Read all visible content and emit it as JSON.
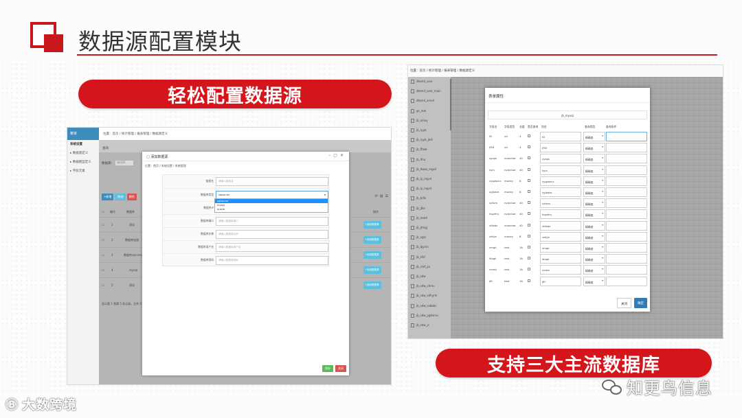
{
  "slide": {
    "title": "数据源配置模块",
    "pill_left": "轻松配置数据源",
    "pill_right": "支持三大主流数据库",
    "colors": {
      "accent": "#c8161d",
      "pill": "#d4161c",
      "link_blue": "#3c8dbc"
    }
  },
  "left_app": {
    "sidebar_header": "菜单",
    "sidebar_items": [
      "系统设置",
      "数据源定义",
      "数据模型定义",
      "字段元素"
    ],
    "breadcrumb": "位置：首页 / 统计管理 / 报表管理 / 数据源定义",
    "panel_header": "查询",
    "search_label": "数据库：",
    "search_value": "请选择...",
    "buttons": [
      "+新增",
      "/修改",
      "删除"
    ],
    "columns": [
      "编号",
      "数据库",
      "操作"
    ],
    "rows": [
      {
        "no": "1",
        "db": "测试",
        "op": "+添加数据源"
      },
      {
        "no": "2",
        "db": "数据库连接",
        "op": "+添加数据源"
      },
      {
        "no": "3",
        "db": "数据库sql server",
        "op": "+添加数据源"
      },
      {
        "no": "4",
        "db": "mysql",
        "op": "+添加数据源"
      },
      {
        "no": "5",
        "db": "测试",
        "op": "+添加数据源"
      }
    ],
    "footer": "显示第 1 到第 5 条记录，总共 5 条记录",
    "modal": {
      "title": "添加数据源",
      "crumb": "位置：首页 / 系统设置 / 系统管理",
      "fields": [
        {
          "label": "链接名",
          "placeholder": "请输入链接名"
        },
        {
          "label": "数据库类型",
          "placeholder": "sqlserver"
        },
        {
          "label": "数据库IP",
          "placeholder": "请输入数据库IP"
        },
        {
          "label": "数据库端口",
          "placeholder": "请输入数据库端口"
        },
        {
          "label": "数据库名称",
          "placeholder": "请输入数据库名称"
        },
        {
          "label": "数据库用户名",
          "placeholder": "请输入数据库用户名"
        },
        {
          "label": "数据库密码",
          "placeholder": "请输入数据库密码"
        }
      ],
      "db_options": [
        "sqlserver",
        "mysql",
        "oracle"
      ],
      "save": "保存",
      "close": "关闭"
    }
  },
  "right_app": {
    "breadcrumb": "位置：首页 / 统计管理 / 报表管理 / 数据源定义",
    "table_list": [
      "dtomd_user",
      "dtomd_user_main",
      "dtomd_xmxll",
      "gs_role",
      "jb_xmxy",
      "jb_ryyb",
      "jb_ryyb_jkdl",
      "jb_fltwb",
      "jb_lfna",
      "jb_ltwas_mgsrl",
      "jb_ly_mgsrl",
      "jb_ly_mgsrl",
      "jb_bdlx",
      "jb_jfke",
      "jb_mdet",
      "jb_jtmgj",
      "jb_xglx",
      "jb_lgysm",
      "jb_cfsf",
      "jb_rdsf_yx",
      "jb_sdw",
      "jb_sdw_chmu",
      "jb_sdw_sdhyrm",
      "jb_sdw_ssbbbs",
      "jb_sdw_ygbsnss",
      "jb_sdw_js"
    ],
    "modal": {
      "title": "表单属性",
      "subtitle": "jb_mysql",
      "columns": [
        "字段名",
        "字段类型",
        "长度",
        "是否查询",
        "别名",
        "查询类型",
        "查询条件"
      ],
      "rows": [
        {
          "name": "ID",
          "type": "int",
          "len": "4",
          "alias": "ID",
          "qtype": "精确查"
        },
        {
          "name": "JFID",
          "type": "int",
          "len": "4",
          "alias": "JFID",
          "qtype": "精确查"
        },
        {
          "name": "xyzgs",
          "type": "nvarchar",
          "len": "40",
          "alias": "xyzgs",
          "qtype": "精确查"
        },
        {
          "name": "kyrs",
          "type": "nvarchar",
          "len": "40",
          "alias": "kyrs",
          "qtype": "精确查"
        },
        {
          "name": "xygzbzcz",
          "type": "money",
          "len": "8",
          "alias": "xygzbzcz",
          "qtype": "精确查"
        },
        {
          "name": "xyjbdzz",
          "type": "money",
          "len": "8",
          "alias": "xyjbdzz",
          "qtype": "精确查"
        },
        {
          "name": "syfwrs",
          "type": "nvarchar",
          "len": "40",
          "alias": "syfwrs",
          "qtype": "精确查"
        },
        {
          "name": "fcgzfmj",
          "type": "nvarchar",
          "len": "40",
          "alias": "fcgzfmj",
          "qtype": "精确查"
        },
        {
          "name": "sfdsbz",
          "type": "nvarchar",
          "len": "40",
          "alias": "sfdsbz",
          "qtype": "精确查"
        },
        {
          "name": "zzfyje",
          "type": "money",
          "len": "8",
          "alias": "zzfyje",
          "qtype": "精确查"
        },
        {
          "name": "xmgk",
          "type": "text",
          "len": "16",
          "alias": "xmgk",
          "qtype": "精确查"
        },
        {
          "name": "ldxgk",
          "type": "text",
          "len": "16",
          "alias": "ldxgk",
          "qtype": "精确查"
        },
        {
          "name": "nxmb",
          "type": "text",
          "len": "16",
          "alias": "nxmb",
          "qtype": "精确查"
        },
        {
          "name": "jffr",
          "type": "text",
          "len": "16",
          "alias": "jffr",
          "qtype": "精确查"
        }
      ],
      "close": "关闭",
      "confirm": "确定"
    }
  },
  "branding": {
    "left_mark": "Ⓑ",
    "left_text": "大数跨境",
    "right_text": "知更鸟信息"
  }
}
